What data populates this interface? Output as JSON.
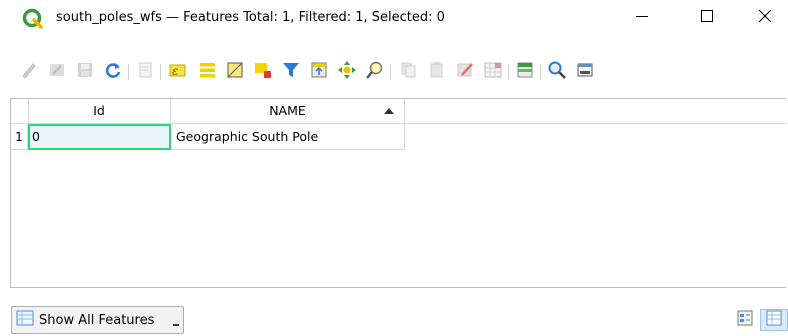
{
  "window": {
    "title": "south_poles_wfs — Features Total: 1, Filtered: 1, Selected: 0",
    "app_icon": "qgis-icon",
    "controls": {
      "minimize": "minimize-icon",
      "maximize": "maximize-icon",
      "close": "close-icon"
    }
  },
  "toolbar": {
    "buttons": [
      {
        "name": "toggle-editing",
        "icon": "pencil-icon",
        "enabled": false
      },
      {
        "name": "toggle-multi-edit",
        "icon": "multi-edit-icon",
        "enabled": false
      },
      {
        "name": "save-edits",
        "icon": "save-icon",
        "enabled": false
      },
      {
        "name": "reload-table",
        "icon": "refresh-icon",
        "enabled": true
      },
      {
        "name": "add-feature",
        "icon": "add-feature-icon",
        "enabled": false
      },
      {
        "name": "select-by-expression",
        "icon": "expression-select-icon",
        "enabled": true
      },
      {
        "name": "select-all",
        "icon": "select-all-icon",
        "enabled": true
      },
      {
        "name": "invert-selection",
        "icon": "invert-selection-icon",
        "enabled": true
      },
      {
        "name": "deselect-all",
        "icon": "deselect-icon",
        "enabled": true
      },
      {
        "name": "filter-select",
        "icon": "filter-icon",
        "enabled": true
      },
      {
        "name": "move-selection-top",
        "icon": "move-top-icon",
        "enabled": true
      },
      {
        "name": "pan-to-selected",
        "icon": "pan-icon",
        "enabled": true
      },
      {
        "name": "zoom-to-selected",
        "icon": "zoom-icon",
        "enabled": true
      },
      {
        "name": "copy-rows",
        "icon": "copy-icon",
        "enabled": false
      },
      {
        "name": "paste-features",
        "icon": "paste-icon",
        "enabled": false
      },
      {
        "name": "delete-features",
        "icon": "delete-icon",
        "enabled": false
      },
      {
        "name": "new-field",
        "icon": "new-field-icon",
        "enabled": false
      },
      {
        "name": "field-calculator",
        "icon": "calculator-icon",
        "enabled": true
      },
      {
        "name": "conditional-formatting",
        "icon": "conditional-format-icon",
        "enabled": true
      },
      {
        "name": "actions",
        "icon": "actions-icon",
        "enabled": true
      },
      {
        "name": "dock",
        "icon": "dock-icon",
        "enabled": true
      }
    ]
  },
  "table": {
    "columns": [
      "Id",
      "NAME"
    ],
    "sorted_column": "NAME",
    "sort_direction": "ascending",
    "rows": [
      {
        "row_number": "1",
        "id": "0",
        "name": "Geographic South Pole"
      }
    ]
  },
  "bottom": {
    "show_features_label": "Show All Features",
    "show_features_icon": "table-icon",
    "form_view_icon": "form-view-icon",
    "table_view_icon": "table-view-icon"
  },
  "colors": {
    "focus_border": "#2fd37a",
    "qgis_green": "#3c9a3c",
    "accent_blue": "#2b7bd0"
  }
}
